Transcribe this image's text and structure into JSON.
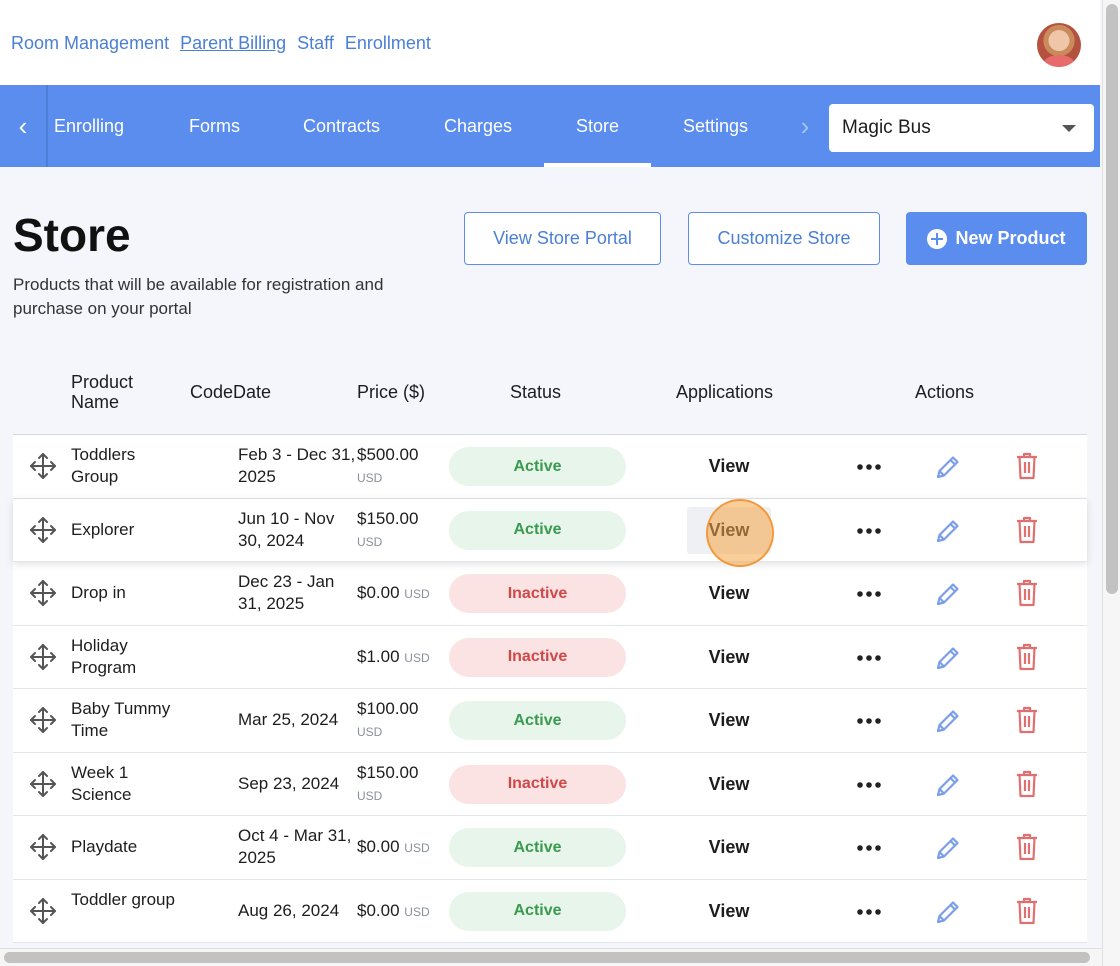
{
  "top_links": [
    "Room Management",
    "Parent Billing",
    "Staff",
    "Enrollment"
  ],
  "nav": {
    "tabs": [
      "Enrolling",
      "Forms",
      "Contracts",
      "Charges",
      "Store",
      "Settings"
    ],
    "active_tab": "Store",
    "site_select": "Magic Bus"
  },
  "page": {
    "title": "Store",
    "subtitle": "Products that will be available for registration and purchase on your portal",
    "view_portal_label": "View Store Portal",
    "customize_label": "Customize Store",
    "new_product_label": "New Product"
  },
  "table": {
    "headers": {
      "product_name": "Product Name",
      "code": "Code",
      "date": "Date",
      "price": "Price ($)",
      "status": "Status",
      "applications": "Applications",
      "actions": "Actions"
    },
    "rows": [
      {
        "name": "Toddlers Group",
        "date": "Feb 3 - Dec 31, 2025",
        "price": "$500.00",
        "currency": "USD",
        "status": "Active",
        "applications": "View"
      },
      {
        "name": "Explorer",
        "date": "Jun 10 - Nov 30, 2024",
        "price": "$150.00",
        "currency": "USD",
        "status": "Active",
        "applications": "View"
      },
      {
        "name": "Drop in",
        "date": "Dec 23 - Jan 31, 2025",
        "price": "$0.00",
        "currency": "USD",
        "status": "Inactive",
        "applications": "View"
      },
      {
        "name": "Holiday Program",
        "date": "",
        "price": "$1.00",
        "currency": "USD",
        "status": "Inactive",
        "applications": "View"
      },
      {
        "name": "Baby Tummy Time",
        "date": "Mar 25, 2024",
        "price": "$100.00",
        "currency": "USD",
        "status": "Active",
        "applications": "View"
      },
      {
        "name": "Week 1 Science",
        "date": "Sep 23, 2024",
        "price": "$150.00",
        "currency": "USD",
        "status": "Inactive",
        "applications": "View"
      },
      {
        "name": "Playdate",
        "date": "Oct 4 - Mar 31, 2025",
        "price": "$0.00",
        "currency": "USD",
        "status": "Active",
        "applications": "View"
      },
      {
        "name": "Toddler group",
        "date": "Aug 26, 2024",
        "price": "$0.00",
        "currency": "USD",
        "status": "Active",
        "applications": "View"
      }
    ]
  },
  "colors": {
    "accent": "#5b8def",
    "active_bg": "#e7f5ea",
    "active_text": "#3a9a4f",
    "inactive_bg": "#fbe3e3",
    "inactive_text": "#d04848",
    "trash": "#e07070",
    "edit": "#7a9ee8"
  }
}
